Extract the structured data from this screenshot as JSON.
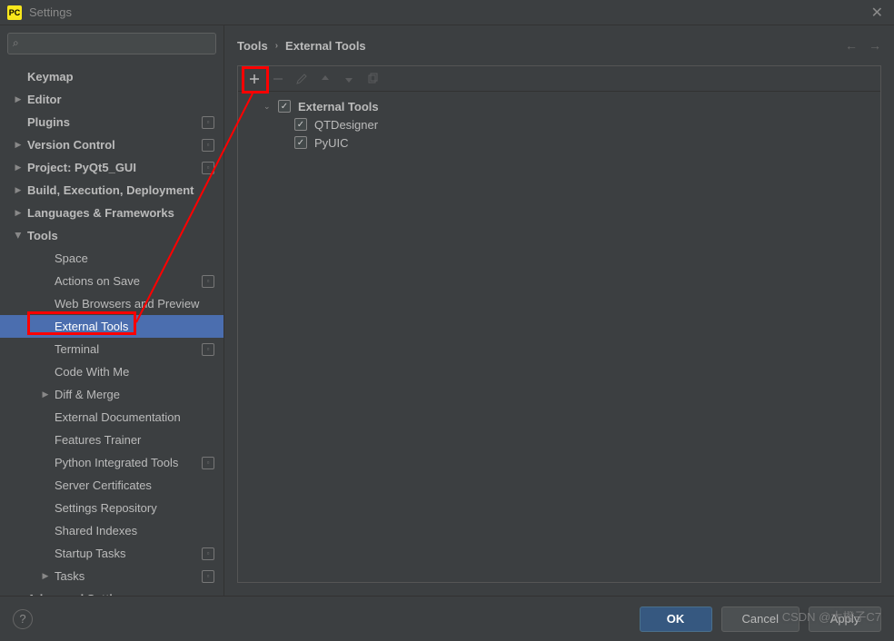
{
  "window": {
    "title": "Settings",
    "app_icon": "PC"
  },
  "search": {
    "placeholder": ""
  },
  "sidebar": {
    "items": [
      {
        "label": "Keymap",
        "arrow": "",
        "badge": false
      },
      {
        "label": "Editor",
        "arrow": "right",
        "badge": false
      },
      {
        "label": "Plugins",
        "arrow": "",
        "badge": true
      },
      {
        "label": "Version Control",
        "arrow": "right",
        "badge": true
      },
      {
        "label": "Project: PyQt5_GUI",
        "arrow": "right",
        "badge": true
      },
      {
        "label": "Build, Execution, Deployment",
        "arrow": "right",
        "badge": false
      },
      {
        "label": "Languages & Frameworks",
        "arrow": "right",
        "badge": false
      },
      {
        "label": "Tools",
        "arrow": "down",
        "badge": false
      },
      {
        "label": "Space",
        "sub": true,
        "badge": false
      },
      {
        "label": "Actions on Save",
        "sub": true,
        "badge": true
      },
      {
        "label": "Web Browsers and Preview",
        "sub": true,
        "badge": false
      },
      {
        "label": "External Tools",
        "sub": true,
        "badge": false,
        "selected": true
      },
      {
        "label": "Terminal",
        "sub": true,
        "badge": true
      },
      {
        "label": "Code With Me",
        "sub": true,
        "badge": false
      },
      {
        "label": "Diff & Merge",
        "sub": true,
        "arrow": "right",
        "badge": false
      },
      {
        "label": "External Documentation",
        "sub": true,
        "badge": false
      },
      {
        "label": "Features Trainer",
        "sub": true,
        "badge": false
      },
      {
        "label": "Python Integrated Tools",
        "sub": true,
        "badge": true
      },
      {
        "label": "Server Certificates",
        "sub": true,
        "badge": false
      },
      {
        "label": "Settings Repository",
        "sub": true,
        "badge": false
      },
      {
        "label": "Shared Indexes",
        "sub": true,
        "badge": false
      },
      {
        "label": "Startup Tasks",
        "sub": true,
        "badge": true
      },
      {
        "label": "Tasks",
        "sub": true,
        "arrow": "right",
        "badge": true
      },
      {
        "label": "Advanced Settings",
        "arrow": "",
        "badge": false
      }
    ]
  },
  "breadcrumb": {
    "root": "Tools",
    "current": "External Tools"
  },
  "toolbar": {
    "add": "+",
    "remove": "−",
    "edit": "✎",
    "up": "▲",
    "down": "▼",
    "copy": "⧉"
  },
  "tree": {
    "group": "External Tools",
    "items": [
      {
        "label": "QTDesigner",
        "checked": true
      },
      {
        "label": "PyUIC",
        "checked": true
      }
    ]
  },
  "buttons": {
    "ok": "OK",
    "cancel": "Cancel",
    "apply": "Apply",
    "help": "?"
  },
  "watermark": "CSDN @大橙子C7"
}
